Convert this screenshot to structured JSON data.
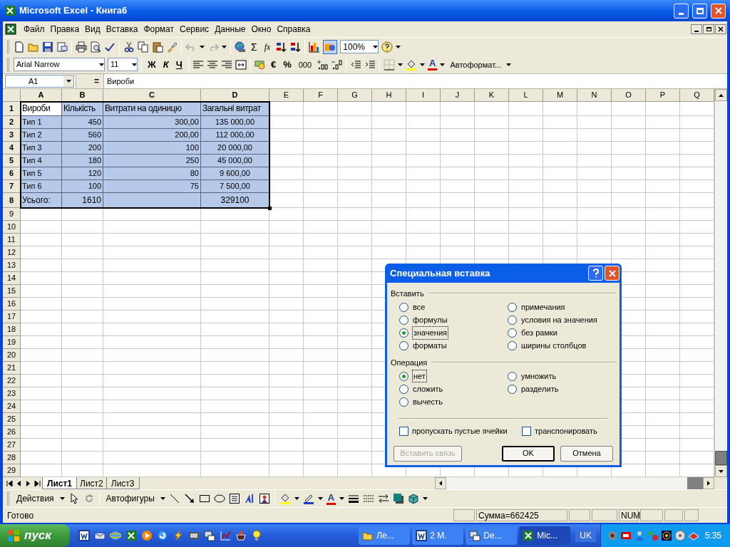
{
  "window": {
    "title": "Microsoft Excel - Книга6"
  },
  "menu": [
    "Файл",
    "Правка",
    "Вид",
    "Вставка",
    "Формат",
    "Сервис",
    "Данные",
    "Окно",
    "Справка"
  ],
  "standard_toolbar": {
    "sum": "Σ",
    "function": "fx",
    "zoom": "100%"
  },
  "formatting_toolbar": {
    "font": "Arial Narrow",
    "size": "11",
    "bold": "Ж",
    "italic": "К",
    "underline": "Ч",
    "euro": "€",
    "percent": "%",
    "thousands": "000",
    "font_color": "A",
    "autoformat": "Автоформат..."
  },
  "formula_bar": {
    "name_box": "A1",
    "equals": "=",
    "formula": "Вироби"
  },
  "sheet": {
    "columns": [
      {
        "label": "A",
        "selected": true
      },
      {
        "label": "B",
        "selected": true
      },
      {
        "label": "C",
        "selected": true
      },
      {
        "label": "D",
        "selected": true
      },
      {
        "label": "E",
        "selected": false
      },
      {
        "label": "F",
        "selected": false
      },
      {
        "label": "G",
        "selected": false
      },
      {
        "label": "H",
        "selected": false
      },
      {
        "label": "I",
        "selected": false
      },
      {
        "label": "J",
        "selected": false
      },
      {
        "label": "K",
        "selected": false
      },
      {
        "label": "L",
        "selected": false
      },
      {
        "label": "M",
        "selected": false
      },
      {
        "label": "N",
        "selected": false
      },
      {
        "label": "O",
        "selected": false
      },
      {
        "label": "P",
        "selected": false
      },
      {
        "label": "Q",
        "selected": false
      }
    ],
    "rows": [
      {
        "number": "1",
        "selected": true,
        "kind": "heading",
        "cells": [
          "Вироби",
          "Кількість",
          "Витрати на одиницю",
          "Загальні витрат"
        ]
      },
      {
        "number": "2",
        "selected": true,
        "kind": "item",
        "cells": [
          "Тип 1",
          "450",
          "300,00",
          "135 000,00"
        ]
      },
      {
        "number": "3",
        "selected": true,
        "kind": "item",
        "cells": [
          "Тип 2",
          "560",
          "200,00",
          "112 000,00"
        ]
      },
      {
        "number": "4",
        "selected": true,
        "kind": "item",
        "cells": [
          "Тип 3",
          "200",
          "100",
          "20 000,00"
        ]
      },
      {
        "number": "5",
        "selected": true,
        "kind": "item",
        "cells": [
          "Тип 4",
          "180",
          "250",
          "45 000,00"
        ]
      },
      {
        "number": "6",
        "selected": true,
        "kind": "item",
        "cells": [
          "Тип 5",
          "120",
          "80",
          "9 600,00"
        ]
      },
      {
        "number": "7",
        "selected": true,
        "kind": "item",
        "cells": [
          "Тип 6",
          "100",
          "75",
          "7 500,00"
        ]
      },
      {
        "number": "8",
        "selected": true,
        "kind": "total",
        "cells": [
          "Усього:",
          "1610",
          "",
          "329100"
        ]
      },
      {
        "number": "9",
        "selected": false
      },
      {
        "number": "10",
        "selected": false
      },
      {
        "number": "11",
        "selected": false
      },
      {
        "number": "12",
        "selected": false
      },
      {
        "number": "13",
        "selected": false
      },
      {
        "number": "14",
        "selected": false
      },
      {
        "number": "15",
        "selected": false
      },
      {
        "number": "16",
        "selected": false
      },
      {
        "number": "17",
        "selected": false
      },
      {
        "number": "18",
        "selected": false
      },
      {
        "number": "19",
        "selected": false
      },
      {
        "number": "20",
        "selected": false
      },
      {
        "number": "21",
        "selected": false
      },
      {
        "number": "22",
        "selected": false
      },
      {
        "number": "23",
        "selected": false
      },
      {
        "number": "24",
        "selected": false
      },
      {
        "number": "25",
        "selected": false
      },
      {
        "number": "26",
        "selected": false
      },
      {
        "number": "27",
        "selected": false
      },
      {
        "number": "28",
        "selected": false
      },
      {
        "number": "29",
        "selected": false
      }
    ]
  },
  "sheet_tabs": [
    {
      "label": "Лист1",
      "selected": true
    },
    {
      "label": "Лист2",
      "selected": false
    },
    {
      "label": "Лист3",
      "selected": false
    }
  ],
  "dialog": {
    "title": "Специальная вставка",
    "paste_group": {
      "label": "Вставить",
      "options": [
        {
          "label": "все",
          "selected": false
        },
        {
          "label": "формулы",
          "selected": false
        },
        {
          "label": "значения",
          "selected": true
        },
        {
          "label": "форматы",
          "selected": false
        },
        {
          "label": "примечания",
          "selected": false
        },
        {
          "label": "условия на значения",
          "selected": false
        },
        {
          "label": "без рамки",
          "selected": false
        },
        {
          "label": "ширины столбцов",
          "selected": false
        }
      ]
    },
    "operation_group": {
      "label": "Операция",
      "options": [
        {
          "label": "нет",
          "selected": true
        },
        {
          "label": "сложить",
          "selected": false
        },
        {
          "label": "вычесть",
          "selected": false
        },
        {
          "label": "умножить",
          "selected": false
        },
        {
          "label": "разделить",
          "selected": false
        }
      ]
    },
    "checkboxes": [
      {
        "label": "пропускать пустые ячейки",
        "checked": false
      },
      {
        "label": "транспонировать",
        "checked": false
      }
    ],
    "buttons": [
      {
        "label": "Вставить связь",
        "disabled": true,
        "default": false
      },
      {
        "label": "OK",
        "disabled": false,
        "default": true
      },
      {
        "label": "Отмена",
        "disabled": false,
        "default": false
      }
    ]
  },
  "drawing_toolbar": {
    "actions": "Действия",
    "autoshapes": "Автофигуры",
    "font_color": "A"
  },
  "status_bar": {
    "status": "Готово",
    "sum": "Сумма=662425",
    "num": "NUM"
  },
  "taskbar": {
    "start": "пуск",
    "tasks": [
      {
        "label": "Ле...",
        "selected": false
      },
      {
        "label": "2 M.",
        "selected": false
      },
      {
        "label": "De...",
        "selected": false
      },
      {
        "label": "Mic...",
        "selected": true
      }
    ],
    "language": "UK",
    "clock": "5:35"
  }
}
